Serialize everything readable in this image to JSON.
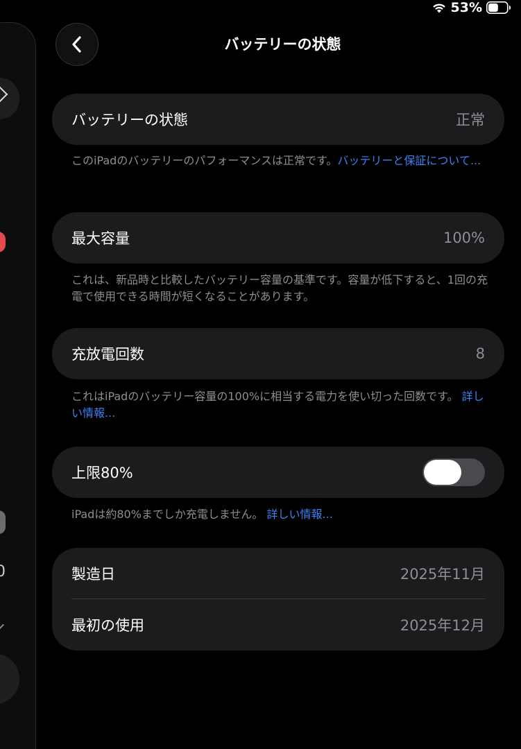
{
  "status_bar": {
    "battery_percent": "53%",
    "battery_level": 0.53
  },
  "nav": {
    "title": "バッテリーの状態"
  },
  "sidebar": {
    "partial_text": "0"
  },
  "battery_health": {
    "label": "バッテリーの状態",
    "value": "正常",
    "footnote_text": "このiPadのバッテリーのパフォーマンスは正常です。",
    "footnote_link": "バッテリーと保証について..."
  },
  "max_capacity": {
    "label": "最大容量",
    "value": "100%",
    "footnote_text": "これは、新品時と比較したバッテリー容量の基準です。容量が低下すると、1回の充電で使用できる時間が短くなることがあります。"
  },
  "cycle_count": {
    "label": "充放電回数",
    "value": "8",
    "footnote_text": "これはiPadのバッテリー容量の100%に相当する電力を使い切った回数です。",
    "footnote_link": "詳しい情報..."
  },
  "limit": {
    "label": "上限80%",
    "toggle_on": false,
    "footnote_text": "iPadは約80%までしか充電しません。",
    "footnote_link": "詳しい情報..."
  },
  "dates": {
    "manufacture_label": "製造日",
    "manufacture_value": "2025年11月",
    "first_use_label": "最初の使用",
    "first_use_value": "2025年12月"
  },
  "colors": {
    "background": "#000000",
    "card": "#1c1c1e",
    "secondary_text": "#8e8e93",
    "link": "#3b82f6",
    "toggle_track_off": "#4a4a4e"
  }
}
